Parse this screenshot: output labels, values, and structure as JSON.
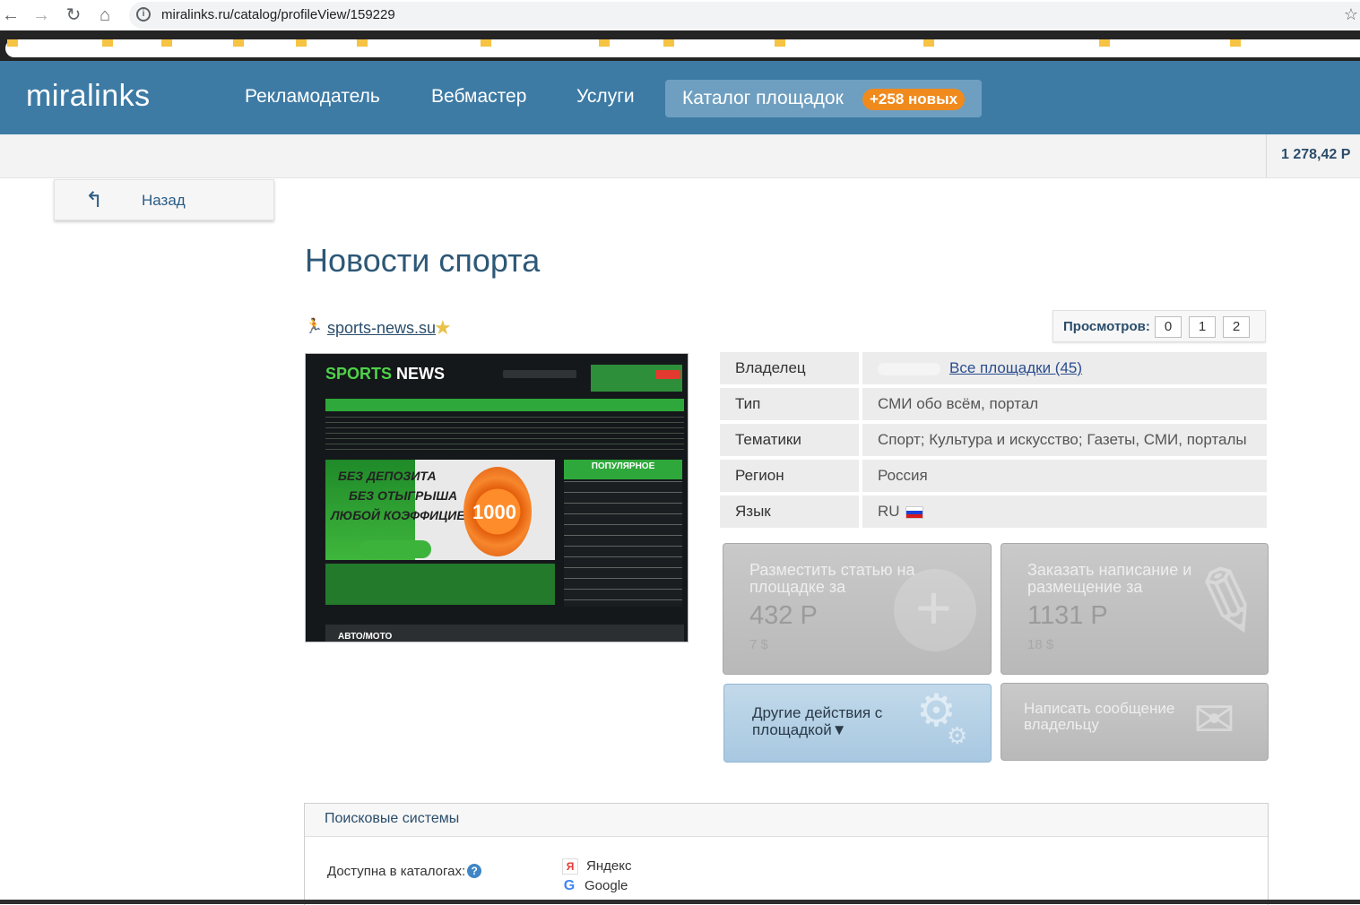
{
  "browser": {
    "url": "miralinks.ru/catalog/profileView/159229"
  },
  "header": {
    "logo": "miralinks",
    "nav": [
      "Рекламодатель",
      "Вебмастер",
      "Услуги"
    ],
    "catalog_tab": "Каталог площадок",
    "catalog_badge": "+258 новых",
    "brand_color": "#3d7ba5",
    "badge_color": "#f08a1c"
  },
  "balance": "1 278,42 Р",
  "back_label": "Назад",
  "page_title": "Новости спорта",
  "site": {
    "url": "sports-news.su"
  },
  "views": {
    "label": "Просмотров:",
    "values": [
      "0",
      "1",
      "2"
    ]
  },
  "thumbnail": {
    "logo_a": "SPORTS",
    "logo_b": " NEWS",
    "banner_line1": "БЕЗ ДЕПОЗИТА",
    "banner_line2": "БЕЗ ОТЫГРЫША",
    "banner_line3": "ЛЮБОЙ КОЭФФИЦИЕНТ",
    "chip": "1000",
    "popular": "ПОПУЛЯРНОЕ",
    "section": "АВТО/МОТО"
  },
  "info": [
    {
      "key": "Владелец",
      "value": "Все площадки (45)"
    },
    {
      "key": "Тип",
      "value": "СМИ обо всём, портал"
    },
    {
      "key": "Тематики",
      "value": "Спорт; Культура и искусство; Газеты, СМИ, порталы"
    },
    {
      "key": "Регион",
      "value": "Россия"
    },
    {
      "key": "Язык",
      "value": "RU"
    }
  ],
  "actions": {
    "place": {
      "title": "Разместить статью на площадке за",
      "price": "432 Р",
      "usd": "7 $"
    },
    "order": {
      "title": "Заказать написание и размещение за",
      "price": "1131 Р",
      "usd": "18 $"
    },
    "other": {
      "title": "Другие действия с площадкой▼"
    },
    "message": {
      "title": "Написать сообщение владельцу"
    }
  },
  "search_section": {
    "title": "Поисковые системы",
    "label": "Доступна в каталогах:",
    "engines": [
      "Яндекс",
      "Google"
    ]
  }
}
